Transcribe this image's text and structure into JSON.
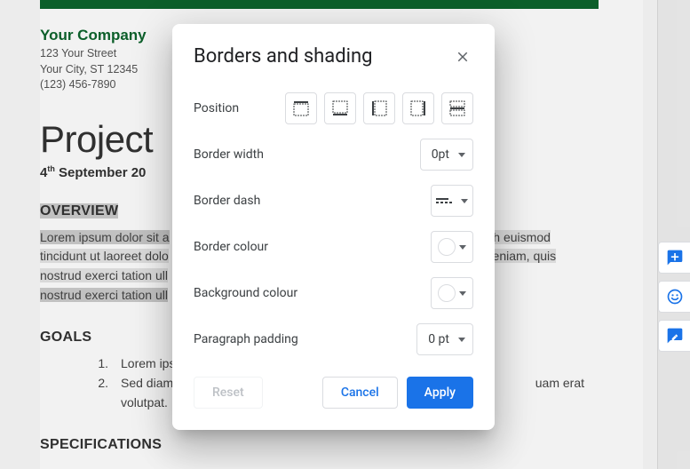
{
  "document": {
    "company_name": "Your Company",
    "addr_line1": "123 Your Street",
    "addr_line2": "Your City, ST 12345",
    "addr_line3": "(123) 456-7890",
    "title": "Project",
    "date_html": "4th September 20",
    "overview_heading": "OVERVIEW",
    "overview_part1": "Lorem ipsum dolor sit a",
    "overview_part2": "h euismod tincidunt ut laoreet dolo",
    "overview_part3": "eniam, quis nostrud exerci tation ull",
    "goals_heading": "GOALS",
    "goal1": "Lorem ipsum do",
    "goal1_num": "1.",
    "goal2_num": "2.",
    "goal2_a": "Sed diam nonun",
    "goal2_b": "uam erat volutpat.",
    "specs_heading": "SPECIFICATIONS"
  },
  "modal": {
    "title": "Borders and shading",
    "labels": {
      "position": "Position",
      "border_width": "Border width",
      "border_dash": "Border dash",
      "border_colour": "Border colour",
      "background_colour": "Background colour",
      "paragraph_padding": "Paragraph padding"
    },
    "values": {
      "border_width": "0pt",
      "paragraph_padding": "0 pt"
    },
    "buttons": {
      "reset": "Reset",
      "cancel": "Cancel",
      "apply": "Apply"
    },
    "position_options": [
      "top",
      "bottom",
      "left",
      "right",
      "between"
    ]
  }
}
